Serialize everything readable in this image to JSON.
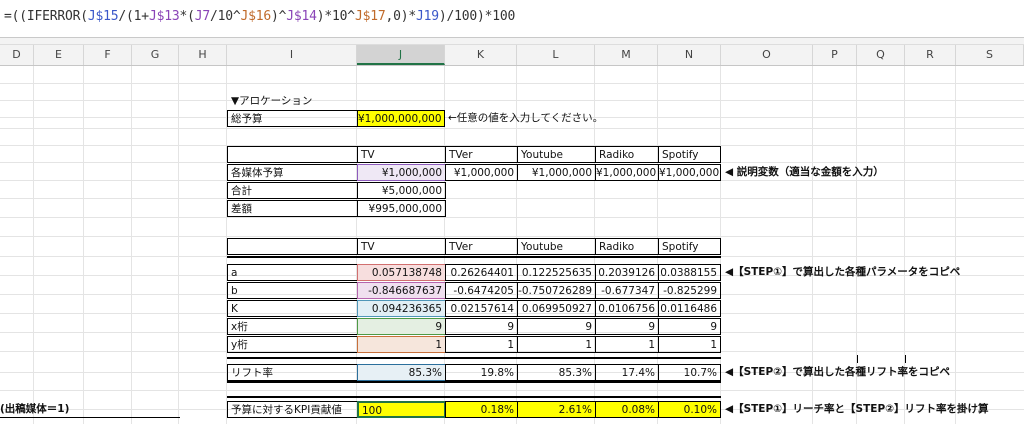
{
  "formula": {
    "parts": [
      "=((IFERROR(",
      "J$15",
      "/(1+",
      "J$13",
      "*(",
      "J7",
      "/10^",
      "J$16",
      ")^",
      "J$14",
      ")*10^",
      "J$17",
      ",0)*",
      "J19",
      ")/100)*100"
    ]
  },
  "columns": [
    "D",
    "E",
    "F",
    "G",
    "H",
    "I",
    "J",
    "K",
    "L",
    "M",
    "N",
    "O",
    "P",
    "Q",
    "R",
    "S"
  ],
  "section_title": "▼アロケーション",
  "total_budget": {
    "label": "総予算",
    "value": "¥1,000,000,000",
    "note": "←任意の値を入力してください。"
  },
  "media_headers": [
    "TV",
    "TVer",
    "Youtube",
    "Radiko",
    "Spotify"
  ],
  "budget_rows": [
    {
      "label": "各媒体予算",
      "values": [
        "¥1,000,000",
        "¥1,000,000",
        "¥1,000,000",
        "¥1,000,000",
        "¥1,000,000"
      ]
    },
    {
      "label": "合計",
      "values": [
        "¥5,000,000"
      ]
    },
    {
      "label": "差額",
      "values": [
        "¥995,000,000"
      ]
    }
  ],
  "budget_note": "◀ 説明変数（適当な金額を入力）",
  "param_rows": [
    {
      "label": "a",
      "values": [
        "0.057138748",
        "0.26264401",
        "0.122525635",
        "0.2039126",
        "0.0388155"
      ]
    },
    {
      "label": "b",
      "values": [
        "-0.846687637",
        "-0.6474205",
        "-0.750726289",
        "-0.677347",
        "-0.825299"
      ]
    },
    {
      "label": "K",
      "values": [
        "0.094236365",
        "0.02157614",
        "0.069950927",
        "0.0106756",
        "0.0116486"
      ]
    },
    {
      "label": "x桁",
      "values": [
        "9",
        "9",
        "9",
        "9",
        "9"
      ]
    },
    {
      "label": "y桁",
      "values": [
        "1",
        "1",
        "1",
        "1",
        "1"
      ]
    }
  ],
  "param_note": "◀【STEP①】で算出した各種パラメータをコピペ",
  "lift": {
    "label": "リフト率",
    "values": [
      "85.3%",
      "19.8%",
      "85.3%",
      "17.4%",
      "10.7%"
    ]
  },
  "lift_note": "◀【STEP②】で算出した各種リフト率をコピペ",
  "kpi": {
    "label": "予算に対するKPI貢献値",
    "values": [
      "100",
      "0.18%",
      "2.61%",
      "0.08%",
      "0.10%"
    ]
  },
  "kpi_note": "◀【STEP①】リーチ率と【STEP②】リフト率を掛け算",
  "left_cut_text": "(出稿媒体＝1)",
  "colors": {
    "highlight": "#ffff00",
    "a": "#f7dede",
    "b": "#f0e0ef",
    "k": "#e1eff5",
    "x": "#e4efe2",
    "y": "#f6e6dc",
    "lift": "#e7f0f5",
    "budget_tv": "#efe8f5"
  }
}
